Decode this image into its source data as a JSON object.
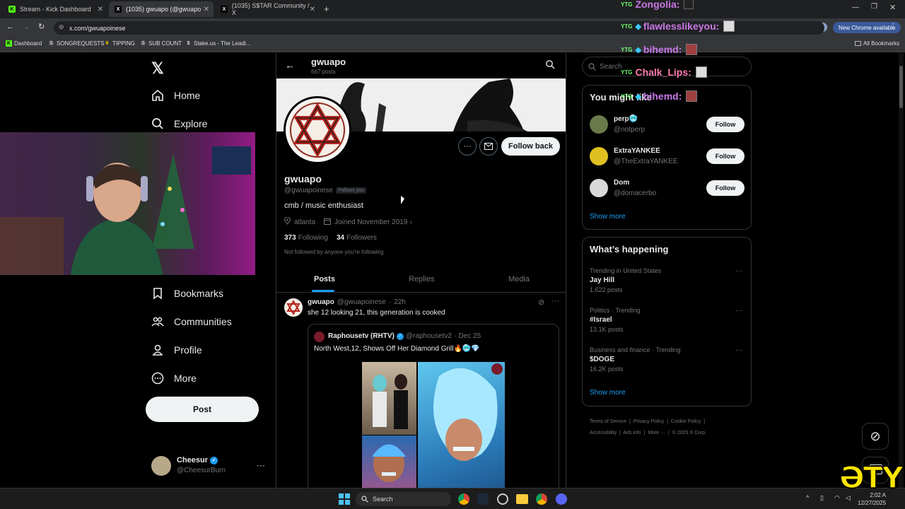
{
  "browser": {
    "tabs": [
      {
        "label": "Stream - Kick Dashboard",
        "icon": "kick-icon"
      },
      {
        "label": "(1035) gwuapo (@gwuapo",
        "icon": "x-icon"
      },
      {
        "label": "(1035) S$TAR Community / X",
        "icon": "x-icon"
      }
    ],
    "url": "x.com/gwuapoinese",
    "new_chrome": "New Chrome available",
    "bookmarks": [
      "Dashboard",
      "SONGREQUESTS",
      "TIPPING",
      "SUB COUNT",
      "Stake.us - The Leadi..."
    ],
    "all_bookmarks": "All Bookmarks"
  },
  "nav": {
    "home": "Home",
    "explore": "Explore",
    "bookmarks": "Bookmarks",
    "communities": "Communities",
    "profile": "Profile",
    "more": "More",
    "post": "Post",
    "account_name": "Cheesur",
    "account_handle": "@CheesurBurn"
  },
  "profile": {
    "header_name": "gwuapo",
    "header_posts": "667 posts",
    "follow_back": "Follow back",
    "name": "gwuapo",
    "handle": "@gwuapoinese",
    "follows_you": "Follows you",
    "bio": "cmb / music enthusiast",
    "location": "atlanta",
    "joined": "Joined November 2019",
    "following_count": "373",
    "following_label": "Following",
    "followers_count": "34",
    "followers_label": "Followers",
    "not_followed": "Not followed by anyone you're following",
    "tabs": [
      "Posts",
      "Replies",
      "Media"
    ]
  },
  "post": {
    "name": "gwuapo",
    "handle": "@gwuapoinese",
    "time": "22h",
    "text": "she 12 looking 21, this generation is cooked",
    "quote_name": "Raphousetv (RHTV)",
    "quote_handle": "@raphousetv2",
    "quote_date": "Dec 25",
    "quote_text": "North West,12, Shows Off Her Diamond Grill🔥🥶💎"
  },
  "search": {
    "placeholder": "Search"
  },
  "who_to_follow": {
    "title": "You might like",
    "users": [
      {
        "name": "perp🥶",
        "handle": "@notperp",
        "button": "Follow"
      },
      {
        "name": "ExtraYANKEE",
        "handle": "@TheExtraYANKEE",
        "button": "Follow"
      },
      {
        "name": "Dom",
        "handle": "@domacerbo",
        "button": "Follow"
      }
    ],
    "show_more": "Show more"
  },
  "trending": {
    "title": "What’s happening",
    "items": [
      {
        "context": "Trending in United States",
        "topic": "Jay Hill",
        "count": "1,622 posts"
      },
      {
        "context": "Politics · Trending",
        "topic": "#Israel",
        "count": "13.1K posts"
      },
      {
        "context": "Business and finance · Trending",
        "topic": "$DOGE",
        "count": "16.2K posts"
      }
    ],
    "show_more": "Show more"
  },
  "footer_links": [
    "Terms of Service",
    "Privacy Policy",
    "Cookie Policy",
    "Accessibility",
    "Ads info",
    "More ···",
    "© 2025 X Corp."
  ],
  "stream_chat": [
    {
      "user": "Zongolia:",
      "color": "#c878e6"
    },
    {
      "user": "flawlesslikeyou:",
      "color": "#c878e6"
    },
    {
      "user": "bihemd:",
      "color": "#c878e6"
    },
    {
      "user": "Chalk_Lips:",
      "color": "#ff7ab0"
    },
    {
      "user": "bihemd:",
      "color": "#c878e6"
    }
  ],
  "overlay": {
    "logo_text": "ƏTY",
    "clock_time": "2:02 A",
    "clock_date": "12/27/2025"
  },
  "taskbar": {
    "search": "Search"
  },
  "colors": {
    "x_blue": "#1d9bf0",
    "follow_bg": "#eff3f4",
    "chrome_bg": "#35363a"
  }
}
